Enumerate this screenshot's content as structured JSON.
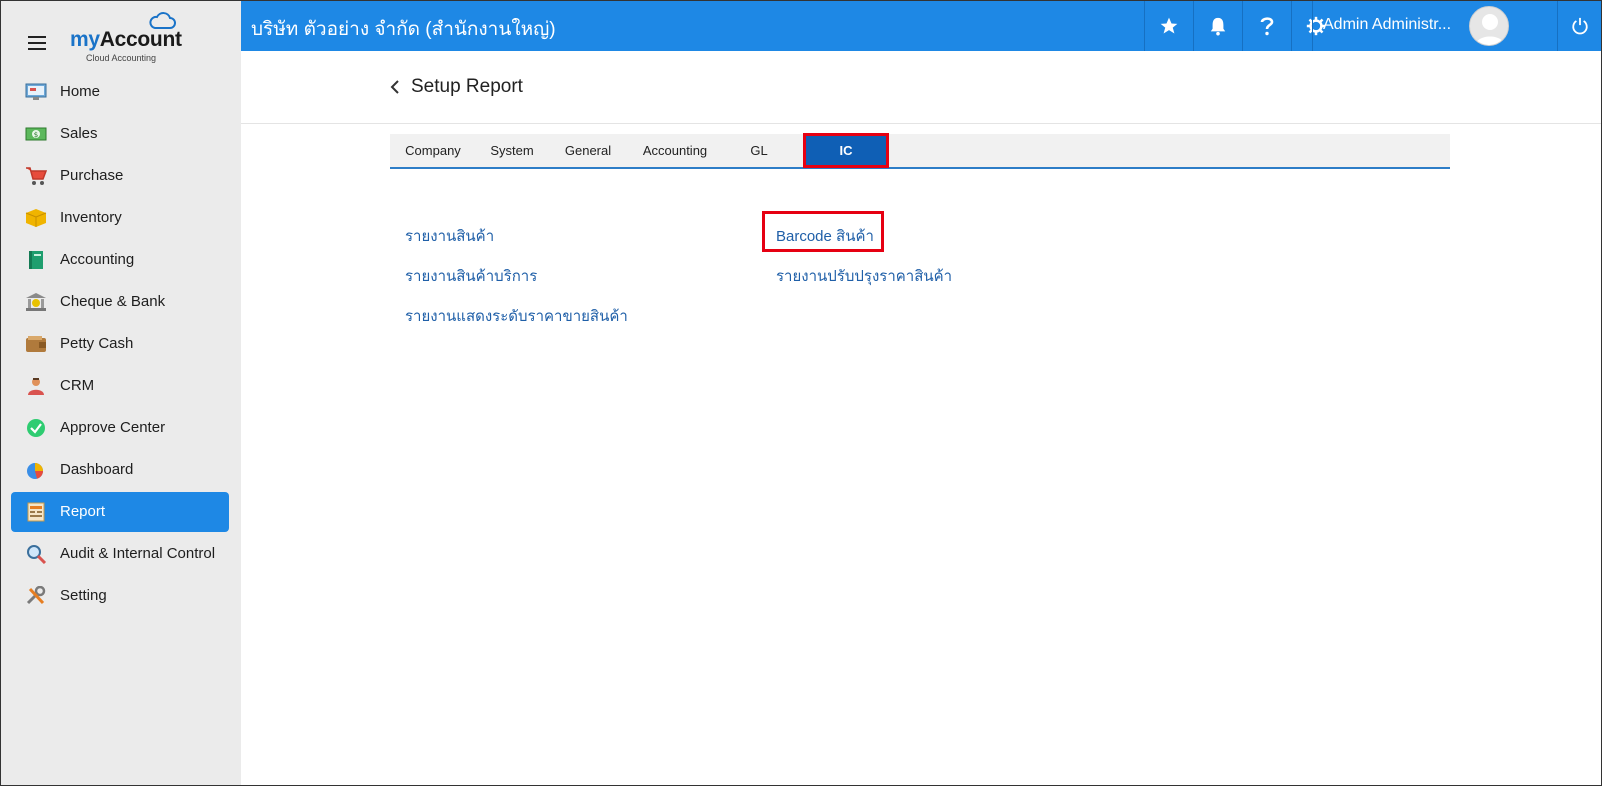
{
  "brand": {
    "name_prefix": "my",
    "name_suffix": "Account",
    "tagline": "Cloud Accounting"
  },
  "sidebar": {
    "items": [
      {
        "label": "Home",
        "icon": "home-monitor-icon"
      },
      {
        "label": "Sales",
        "icon": "cash-icon"
      },
      {
        "label": "Purchase",
        "icon": "shopping-cart-icon"
      },
      {
        "label": "Inventory",
        "icon": "box-icon"
      },
      {
        "label": "Accounting",
        "icon": "book-icon"
      },
      {
        "label": "Cheque & Bank",
        "icon": "bank-icon"
      },
      {
        "label": "Petty Cash",
        "icon": "wallet-icon"
      },
      {
        "label": "CRM",
        "icon": "people-icon"
      },
      {
        "label": "Approve Center",
        "icon": "check-circle-icon"
      },
      {
        "label": "Dashboard",
        "icon": "pie-chart-icon"
      },
      {
        "label": "Report",
        "icon": "report-document-icon"
      },
      {
        "label": "Audit & Internal Control",
        "icon": "magnifier-icon"
      },
      {
        "label": "Setting",
        "icon": "tools-icon"
      }
    ],
    "active_index": 10
  },
  "topbar": {
    "company": "บริษัท ตัวอย่าง จำกัด (สำนักงานใหญ่)",
    "user_name": "Admin Administr..."
  },
  "page": {
    "title": "Setup Report"
  },
  "tabs": [
    {
      "label": "Company"
    },
    {
      "label": "System"
    },
    {
      "label": "General"
    },
    {
      "label": "Accounting"
    },
    {
      "label": "GL"
    },
    {
      "label": "IC"
    }
  ],
  "active_tab": "IC",
  "reports": {
    "col1": [
      "รายงานสินค้า",
      "รายงานสินค้าบริการ",
      "รายงานแสดงระดับราคาขายสินค้า"
    ],
    "col2": [
      "Barcode สินค้า",
      "รายงานปรับปรุงราคาสินค้า"
    ]
  },
  "colors": {
    "primary": "#1e88e5",
    "active_tab": "#0f5fb5",
    "highlight": "#e60012",
    "link": "#1f5fa8"
  }
}
